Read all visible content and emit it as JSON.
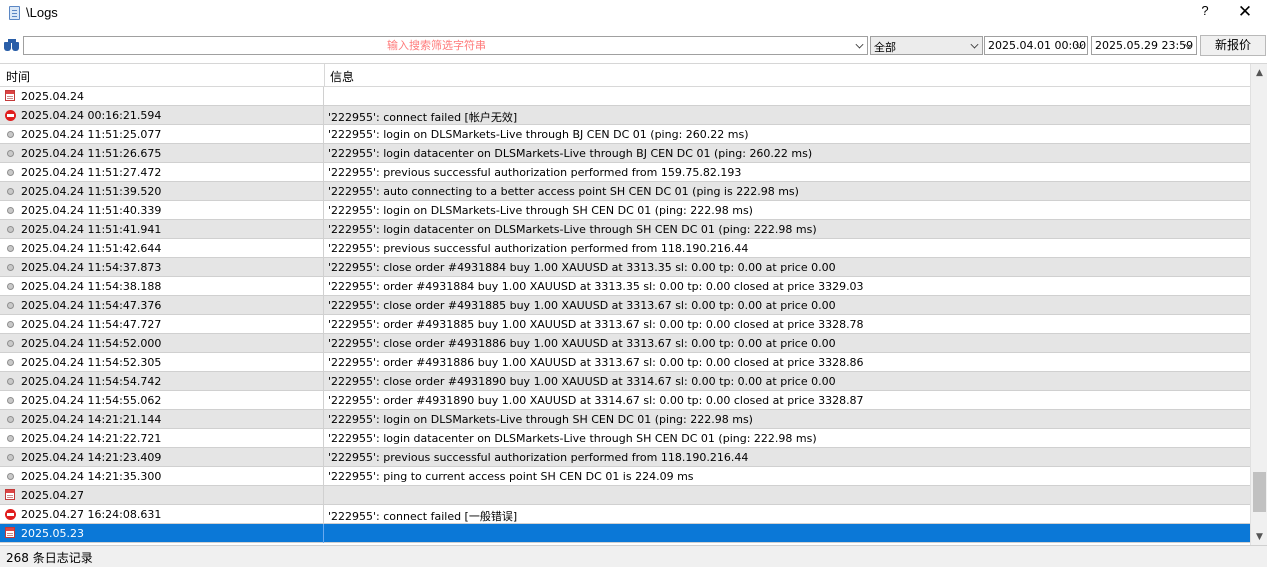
{
  "window": {
    "title": "\\Logs",
    "help_label": "?",
    "close_label": "✕"
  },
  "toolbar": {
    "search_placeholder": "输入搜索筛选字符串",
    "search_value": "",
    "category": "全部",
    "date_from": "2025.04.01 00:00",
    "date_to": "2025.05.29 23:59",
    "refresh_label": "新报价"
  },
  "table": {
    "columns": {
      "time": "时间",
      "message": "信息"
    },
    "rows": [
      {
        "icon": "date",
        "time": "2025.04.24",
        "message": ""
      },
      {
        "icon": "error",
        "time": "2025.04.24 00:16:21.594",
        "message": "'222955': connect failed [帐户无效]"
      },
      {
        "icon": "info",
        "time": "2025.04.24 11:51:25.077",
        "message": "'222955': login on DLSMarkets-Live through BJ CEN DC 01 (ping: 260.22 ms)"
      },
      {
        "icon": "info",
        "time": "2025.04.24 11:51:26.675",
        "message": "'222955': login datacenter on DLSMarkets-Live through BJ CEN DC 01 (ping: 260.22 ms)"
      },
      {
        "icon": "info",
        "time": "2025.04.24 11:51:27.472",
        "message": "'222955': previous successful authorization performed from 159.75.82.193"
      },
      {
        "icon": "info",
        "time": "2025.04.24 11:51:39.520",
        "message": "'222955': auto connecting to a better access point SH CEN DC 01 (ping is 222.98 ms)"
      },
      {
        "icon": "info",
        "time": "2025.04.24 11:51:40.339",
        "message": "'222955': login on DLSMarkets-Live through SH CEN DC 01 (ping: 222.98 ms)"
      },
      {
        "icon": "info",
        "time": "2025.04.24 11:51:41.941",
        "message": "'222955': login datacenter on DLSMarkets-Live through SH CEN DC 01 (ping: 222.98 ms)"
      },
      {
        "icon": "info",
        "time": "2025.04.24 11:51:42.644",
        "message": "'222955': previous successful authorization performed from 118.190.216.44"
      },
      {
        "icon": "info",
        "time": "2025.04.24 11:54:37.873",
        "message": "'222955': close order #4931884 buy 1.00 XAUUSD at 3313.35 sl: 0.00 tp: 0.00 at price 0.00"
      },
      {
        "icon": "info",
        "time": "2025.04.24 11:54:38.188",
        "message": "'222955': order #4931884 buy 1.00 XAUUSD at 3313.35 sl: 0.00 tp: 0.00 closed at price 3329.03"
      },
      {
        "icon": "info",
        "time": "2025.04.24 11:54:47.376",
        "message": "'222955': close order #4931885 buy 1.00 XAUUSD at 3313.67 sl: 0.00 tp: 0.00 at price 0.00"
      },
      {
        "icon": "info",
        "time": "2025.04.24 11:54:47.727",
        "message": "'222955': order #4931885 buy 1.00 XAUUSD at 3313.67 sl: 0.00 tp: 0.00 closed at price 3328.78"
      },
      {
        "icon": "info",
        "time": "2025.04.24 11:54:52.000",
        "message": "'222955': close order #4931886 buy 1.00 XAUUSD at 3313.67 sl: 0.00 tp: 0.00 at price 0.00"
      },
      {
        "icon": "info",
        "time": "2025.04.24 11:54:52.305",
        "message": "'222955': order #4931886 buy 1.00 XAUUSD at 3313.67 sl: 0.00 tp: 0.00 closed at price 3328.86"
      },
      {
        "icon": "info",
        "time": "2025.04.24 11:54:54.742",
        "message": "'222955': close order #4931890 buy 1.00 XAUUSD at 3314.67 sl: 0.00 tp: 0.00 at price 0.00"
      },
      {
        "icon": "info",
        "time": "2025.04.24 11:54:55.062",
        "message": "'222955': order #4931890 buy 1.00 XAUUSD at 3314.67 sl: 0.00 tp: 0.00 closed at price 3328.87"
      },
      {
        "icon": "info",
        "time": "2025.04.24 14:21:21.144",
        "message": "'222955': login on DLSMarkets-Live through SH CEN DC 01 (ping: 222.98 ms)"
      },
      {
        "icon": "info",
        "time": "2025.04.24 14:21:22.721",
        "message": "'222955': login datacenter on DLSMarkets-Live through SH CEN DC 01 (ping: 222.98 ms)"
      },
      {
        "icon": "info",
        "time": "2025.04.24 14:21:23.409",
        "message": "'222955': previous successful authorization performed from 118.190.216.44"
      },
      {
        "icon": "info",
        "time": "2025.04.24 14:21:35.300",
        "message": "'222955': ping to current access point SH CEN DC 01 is 224.09 ms"
      },
      {
        "icon": "date",
        "time": "2025.04.27",
        "message": ""
      },
      {
        "icon": "error",
        "time": "2025.04.27 16:24:08.631",
        "message": "'222955': connect failed [一般错误]"
      },
      {
        "icon": "date",
        "time": "2025.05.23",
        "message": "",
        "selected": true
      }
    ]
  },
  "scrollbar": {
    "up": "▲",
    "down": "▼"
  },
  "status": {
    "text": "268 条日志记录"
  }
}
